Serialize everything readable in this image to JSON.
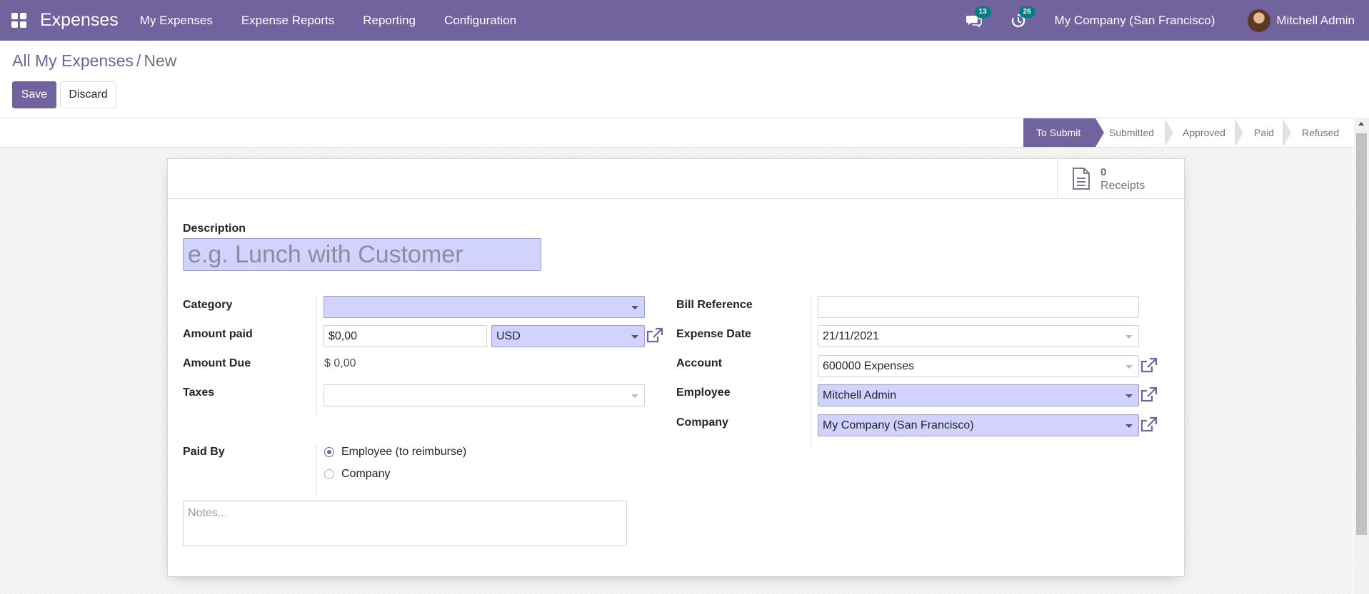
{
  "navbar": {
    "app_title": "Expenses",
    "menu": [
      "My Expenses",
      "Expense Reports",
      "Reporting",
      "Configuration"
    ],
    "messages_count": "13",
    "activities_count": "26",
    "company": "My Company (San Francisco)",
    "user": "Mitchell Admin"
  },
  "breadcrumb": {
    "parent": "All My Expenses",
    "separator": "/",
    "current": "New"
  },
  "buttons": {
    "save": "Save",
    "discard": "Discard"
  },
  "statusbar": {
    "stages": [
      "To Submit",
      "Submitted",
      "Approved",
      "Paid",
      "Refused"
    ],
    "active": "To Submit"
  },
  "smart_button": {
    "count": "0",
    "label": "Receipts"
  },
  "form": {
    "description_label": "Description",
    "description_placeholder": "e.g. Lunch with Customer",
    "category_label": "Category",
    "category_value": "",
    "amount_paid_label": "Amount paid",
    "amount_paid_value": "$0,00",
    "currency_value": "USD",
    "amount_due_label": "Amount Due",
    "amount_due_value": "$ 0,00",
    "taxes_label": "Taxes",
    "taxes_value": "",
    "paid_by_label": "Paid By",
    "paid_by_options": [
      "Employee (to reimburse)",
      "Company"
    ],
    "paid_by_selected": "Employee (to reimburse)",
    "bill_reference_label": "Bill Reference",
    "bill_reference_value": "",
    "expense_date_label": "Expense Date",
    "expense_date_value": "21/11/2021",
    "account_label": "Account",
    "account_value": "600000 Expenses",
    "employee_label": "Employee",
    "employee_value": "Mitchell Admin",
    "company_label": "Company",
    "company_value": "My Company (San Francisco)",
    "notes_placeholder": "Notes..."
  },
  "colors": {
    "brand": "#71639e",
    "required_field": "#d2d2ff",
    "badge": "#017e84"
  },
  "icons": [
    "apps-grid-icon",
    "chat-bubbles-icon",
    "clock-activity-icon",
    "document-icon",
    "external-link-icon"
  ]
}
